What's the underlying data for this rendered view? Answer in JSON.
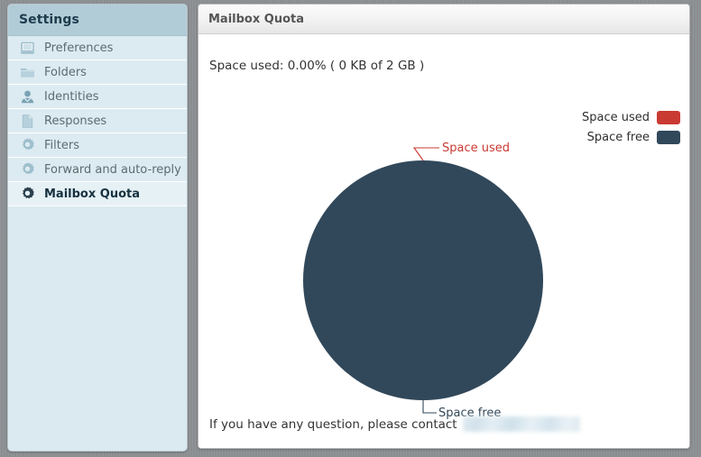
{
  "sidebar": {
    "header": "Settings",
    "items": [
      {
        "label": "Preferences",
        "icon": "laptop-icon",
        "selected": false
      },
      {
        "label": "Folders",
        "icon": "folder-icon",
        "selected": false
      },
      {
        "label": "Identities",
        "icon": "person-icon",
        "selected": false
      },
      {
        "label": "Responses",
        "icon": "document-icon",
        "selected": false
      },
      {
        "label": "Filters",
        "icon": "gear-icon",
        "selected": false
      },
      {
        "label": "Forward and auto-reply",
        "icon": "gear-icon",
        "selected": false
      },
      {
        "label": "Mailbox Quota",
        "icon": "gear-icon",
        "selected": true
      }
    ]
  },
  "main": {
    "header_title": "Mailbox Quota",
    "space_used_line": "Space used: 0.00% ( 0 KB of 2 GB )",
    "footer_note": "If you have any question, please contact",
    "footer_redacted": ""
  },
  "legend": {
    "items": [
      {
        "label": "Space used",
        "color": "#c93a32"
      },
      {
        "label": "Space free",
        "color": "#31485a"
      }
    ]
  },
  "chart_data": {
    "type": "pie",
    "title": "Mailbox Quota",
    "categories": [
      "Space used",
      "Space free"
    ],
    "values": [
      0.0,
      100.0
    ],
    "units": "percent",
    "labels": [
      "Space used",
      "Space free"
    ],
    "colors": [
      "#c93a32",
      "#31485a"
    ],
    "annotations": [
      {
        "text": "Space used",
        "color": "#c9453c"
      },
      {
        "text": "Space free",
        "color": "#31485a"
      }
    ],
    "legend_position": "top-right",
    "total_quota": "2 GB",
    "used_amount": "0 KB",
    "used_percent": "0.00%",
    "grid": false
  }
}
